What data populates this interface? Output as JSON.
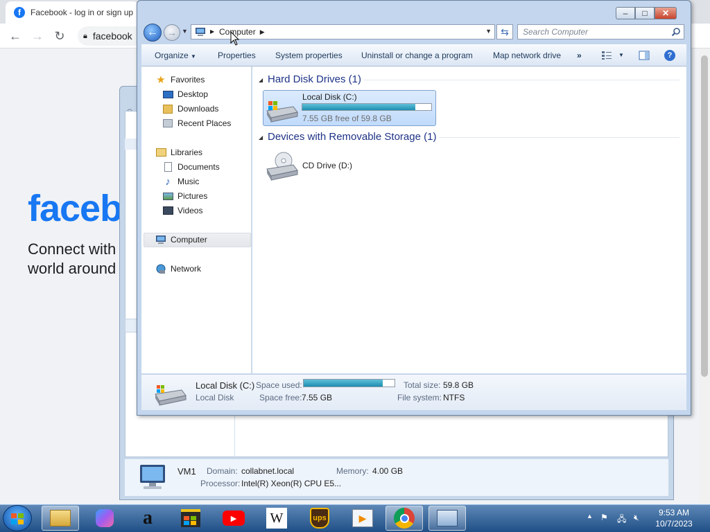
{
  "browser": {
    "tab_title": "Facebook - log in or sign up",
    "url_fragment": "facebook"
  },
  "facebook": {
    "logo_text": "faceb",
    "tagline_line1": "Connect with",
    "tagline_line2": "world around"
  },
  "system_window": {
    "computer_name": "VM1",
    "domain_label": "Domain:",
    "domain_value": "collabnet.local",
    "memory_label": "Memory:",
    "memory_value": "4.00 GB",
    "processor_label": "Processor:",
    "processor_value": "Intel(R) Xeon(R) CPU E5..."
  },
  "explorer": {
    "titlebar": {
      "minimize": "‒",
      "maximize": "□",
      "close": "✕"
    },
    "address": {
      "crumb": "Computer"
    },
    "search": {
      "placeholder": "Search Computer"
    },
    "commands": {
      "organize": "Organize",
      "properties": "Properties",
      "system_properties": "System properties",
      "uninstall": "Uninstall or change a program",
      "map_drive": "Map network drive",
      "more": "»",
      "help": "?"
    },
    "nav": {
      "favorites": "Favorites",
      "desktop": "Desktop",
      "downloads": "Downloads",
      "recent": "Recent Places",
      "libraries": "Libraries",
      "documents": "Documents",
      "music": "Music",
      "pictures": "Pictures",
      "videos": "Videos",
      "computer": "Computer",
      "network": "Network"
    },
    "groups": {
      "hdd": "Hard Disk Drives (1)",
      "removable": "Devices with Removable Storage (1)"
    },
    "drives": {
      "c_name": "Local Disk (C:)",
      "c_free": "7.55 GB free of 59.8 GB",
      "c_used_fraction": 0.874,
      "d_name": "CD Drive (D:)"
    },
    "details": {
      "name": "Local Disk (C:)",
      "type": "Local Disk",
      "space_used_label": "Space used:",
      "space_free_label": "Space free:",
      "space_free_value": "7.55 GB",
      "total_size_label": "Total size:",
      "total_size_value": "59.8 GB",
      "file_system_label": "File system:",
      "file_system_value": "NTFS",
      "used_fraction": 0.874
    }
  },
  "taskbar": {
    "time": "9:53 AM",
    "date": "10/7/2023",
    "apps": [
      "explorer-icon",
      "copilot-icon",
      "amazon-icon",
      "store-icon",
      "youtube-icon",
      "wikipedia-icon",
      "ups-icon",
      "media-icon",
      "chrome-icon",
      "remote-desktop-icon"
    ],
    "wikipedia_glyph": "W",
    "amazon_glyph": "a",
    "ups_glyph": "ups"
  }
}
